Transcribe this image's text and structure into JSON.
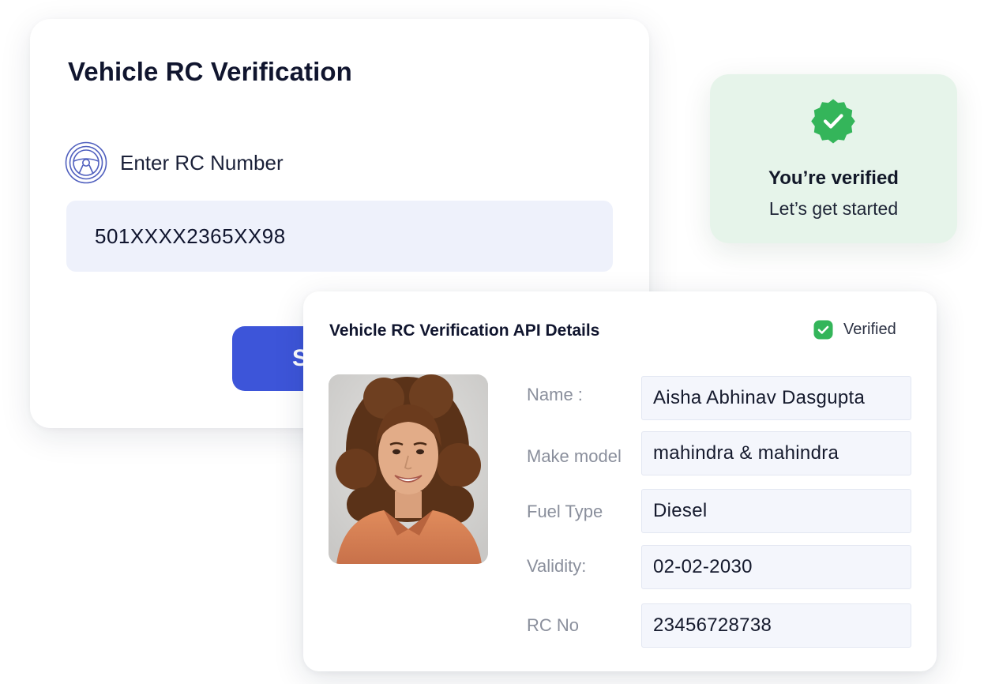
{
  "form_card": {
    "title": "Vehicle RC Verification",
    "rc_label": "Enter RC Number",
    "rc_value": "501XXXX2365XX98",
    "submit_label": "S",
    "icon": "steering-wheel-icon"
  },
  "verified_card": {
    "title": "You’re verified",
    "subtitle": "Let’s get started",
    "icon": "verified-badge-icon",
    "accent": "#34b55a"
  },
  "details_card": {
    "title": "Vehicle RC Verification API Details",
    "status_label": "Verified",
    "status_icon": "check-circle-icon",
    "fields": [
      {
        "label": "Name :",
        "value": "Aisha Abhinav Dasgupta"
      },
      {
        "label": "Make model",
        "value": "mahindra & mahindra"
      },
      {
        "label": "Fuel Type",
        "value": "Diesel"
      },
      {
        "label": "Validity:",
        "value": "02-02-2030"
      },
      {
        "label": "RC No",
        "value": "23456728738"
      }
    ]
  },
  "colors": {
    "primary_button": "#3d55d9",
    "input_bg": "#eef1fb",
    "verified_bg": "#e6f4ea",
    "success_green": "#34b55a"
  }
}
